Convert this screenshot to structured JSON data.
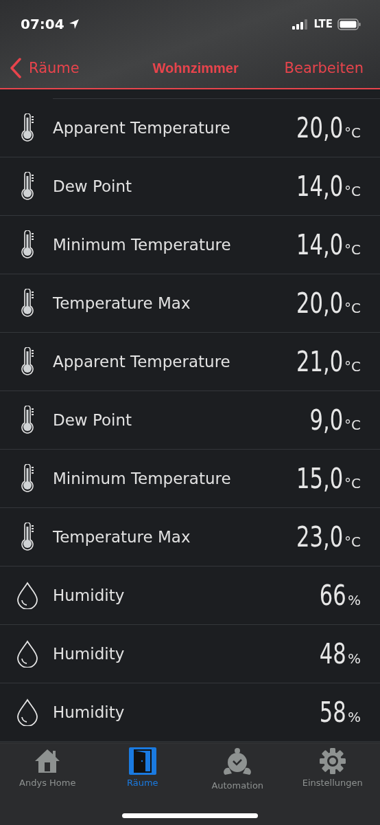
{
  "status_bar": {
    "time": "07:04",
    "network": "LTE"
  },
  "nav": {
    "back": "Räume",
    "title": "Wohnzimmer",
    "action": "Bearbeiten"
  },
  "sensors": [
    {
      "kind": "temperature",
      "name": "Apparent Temperature",
      "value": "20,0",
      "unit": "°C"
    },
    {
      "kind": "temperature",
      "name": "Dew Point",
      "value": "14,0",
      "unit": "°C"
    },
    {
      "kind": "temperature",
      "name": "Minimum Temperature",
      "value": "14,0",
      "unit": "°C"
    },
    {
      "kind": "temperature",
      "name": "Temperature Max",
      "value": "20,0",
      "unit": "°C"
    },
    {
      "kind": "temperature",
      "name": "Apparent Temperature",
      "value": "21,0",
      "unit": "°C"
    },
    {
      "kind": "temperature",
      "name": "Dew Point",
      "value": "9,0",
      "unit": "°C"
    },
    {
      "kind": "temperature",
      "name": "Minimum Temperature",
      "value": "15,0",
      "unit": "°C"
    },
    {
      "kind": "temperature",
      "name": "Temperature Max",
      "value": "23,0",
      "unit": "°C"
    },
    {
      "kind": "humidity",
      "name": "Humidity",
      "value": "66",
      "unit": "%"
    },
    {
      "kind": "humidity",
      "name": "Humidity",
      "value": "48",
      "unit": "%"
    },
    {
      "kind": "humidity",
      "name": "Humidity",
      "value": "58",
      "unit": "%"
    }
  ],
  "tabs": [
    {
      "kind": "home",
      "label": "Andys Home",
      "selected": false
    },
    {
      "kind": "rooms",
      "label": "Räume",
      "selected": true
    },
    {
      "kind": "automation",
      "label": "Automation",
      "selected": false
    },
    {
      "kind": "settings",
      "label": "Einstellungen",
      "selected": false
    }
  ]
}
